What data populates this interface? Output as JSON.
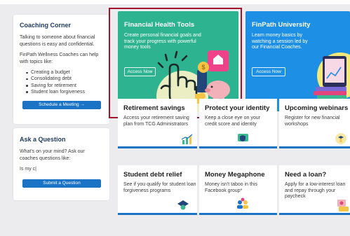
{
  "coaching": {
    "title": "Coaching Corner",
    "intro": "Talking to someone about financial questions is easy and confidential.",
    "help_text": "FinPath Wellness Coaches can help with topics like:",
    "topics": [
      "Creating a budget",
      "Consolidating debt",
      "Saving for retirement",
      "Student loan forgiveness"
    ],
    "button": "Schedule a Meeting →"
  },
  "ask": {
    "title": "Ask a Question",
    "prompt": "What's on your mind? Ask our coaches questions like:",
    "input_value": "Is my c|",
    "button": "Submit a Question"
  },
  "hero_tiles": [
    {
      "title": "Financial Health Tools",
      "desc": "Create personal financial goals and track your progress with powerful money tools",
      "button": "Access Now"
    },
    {
      "title": "FinPath University",
      "desc": "Learn money basics by watching a session led by our Financial Coaches.",
      "button": "Access Now"
    }
  ],
  "tiles": [
    {
      "title": "Retirement savings",
      "desc": "Access your retirement saving plan from TCG Administrators"
    },
    {
      "title": "Protect your identity",
      "desc": "Keep a close eye on your credit score and identity"
    },
    {
      "title": "Upcoming webinars",
      "desc": "Register for new financial workshops"
    },
    {
      "title": "Student debt relief",
      "desc": "See if you qualify for student loan forgiveness programs"
    },
    {
      "title": "Money Megaphone",
      "desc": "Money isn't taboo in this Facebook group*"
    },
    {
      "title": "Need a loan?",
      "desc": "Apply for a low-interest loan and repay through your paycheck"
    }
  ],
  "colors": {
    "accent_blue": "#1a73c4",
    "teal": "#2db38f",
    "sky": "#1d8fe4",
    "highlight": "#a3142a"
  },
  "icons": [
    "growth-chart-icon",
    "shield-id-icon",
    "webinar-bulb-icon",
    "graduation-cap-icon",
    "megaphone-group-icon",
    "loan-money-icon",
    "tap-hand-icon",
    "piggy-bank-icon",
    "laptop-books-icon"
  ]
}
